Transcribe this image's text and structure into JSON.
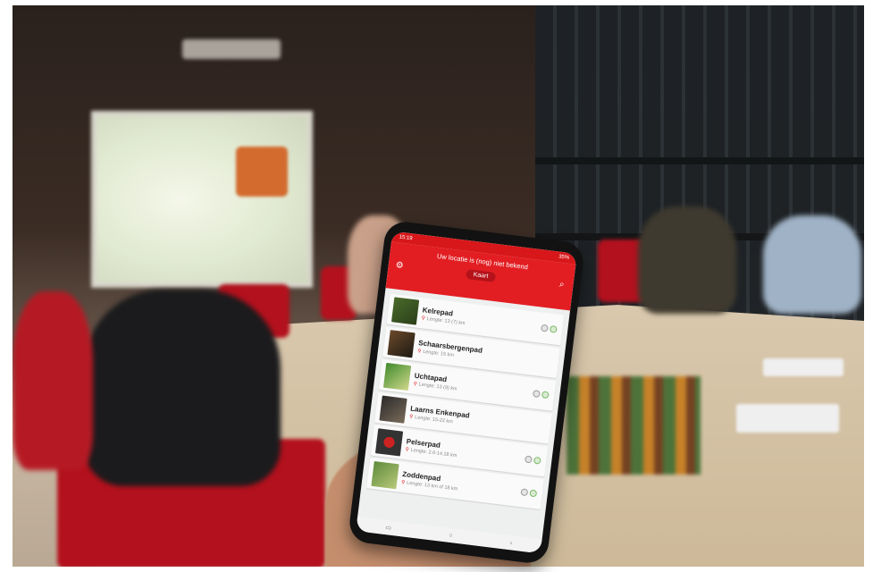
{
  "app": {
    "status_time": "15:19",
    "status_battery": "35%",
    "location_message": "Uw locatie is (nog) niet bekend",
    "map_button": "Kaart",
    "gear_icon": "gear-icon",
    "search_icon": "search-icon"
  },
  "routes": [
    {
      "name": "Kelrepad",
      "detail": "Lengte: 13 (7) km"
    },
    {
      "name": "Schaarsbergenpad",
      "detail": "Lengte: 15 km"
    },
    {
      "name": "Uchtapad",
      "detail": "Lengte: 13 (9) km"
    },
    {
      "name": "Laarns Enkenpad",
      "detail": "Lengte: 15-22 km"
    },
    {
      "name": "Pelserpad",
      "detail": "Lengte: 2.6-14.18 km"
    },
    {
      "name": "Zoddenpad",
      "detail": "Lengte: 13 km of 18 km"
    }
  ],
  "colors": {
    "brand": "#e21e23",
    "brand_dark": "#b5121a"
  }
}
